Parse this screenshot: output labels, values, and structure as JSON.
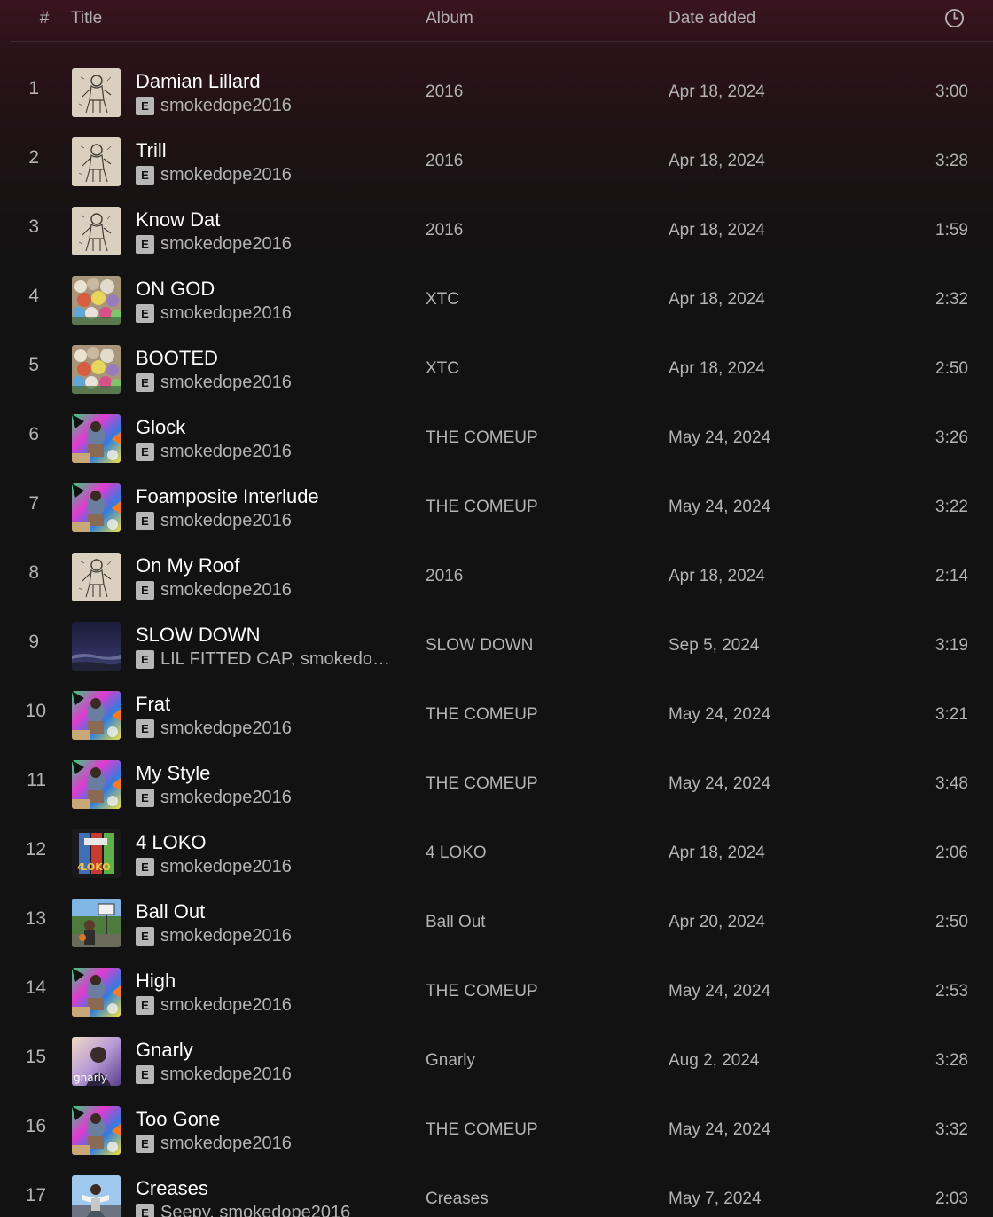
{
  "header": {
    "num_label": "#",
    "title_label": "Title",
    "album_label": "Album",
    "date_label": "Date added",
    "duration_icon": "clock-icon"
  },
  "tracks": [
    {
      "num": "1",
      "title": "Damian Lillard",
      "explicit": "E",
      "artist": "smokedope2016",
      "album": "2016",
      "date": "Apr 18, 2024",
      "duration": "3:00",
      "art": "art-2016"
    },
    {
      "num": "2",
      "title": "Trill",
      "explicit": "E",
      "artist": "smokedope2016",
      "album": "2016",
      "date": "Apr 18, 2024",
      "duration": "3:28",
      "art": "art-2016"
    },
    {
      "num": "3",
      "title": "Know Dat",
      "explicit": "E",
      "artist": "smokedope2016",
      "album": "2016",
      "date": "Apr 18, 2024",
      "duration": "1:59",
      "art": "art-2016"
    },
    {
      "num": "4",
      "title": "ON GOD",
      "explicit": "E",
      "artist": "smokedope2016",
      "album": "XTC",
      "date": "Apr 18, 2024",
      "duration": "2:32",
      "art": "art-xtc"
    },
    {
      "num": "5",
      "title": "BOOTED",
      "explicit": "E",
      "artist": "smokedope2016",
      "album": "XTC",
      "date": "Apr 18, 2024",
      "duration": "2:50",
      "art": "art-xtc"
    },
    {
      "num": "6",
      "title": "Glock",
      "explicit": "E",
      "artist": "smokedope2016",
      "album": "THE COMEUP",
      "date": "May 24, 2024",
      "duration": "3:26",
      "art": "art-comeup"
    },
    {
      "num": "7",
      "title": "Foamposite Interlude",
      "explicit": "E",
      "artist": "smokedope2016",
      "album": "THE COMEUP",
      "date": "May 24, 2024",
      "duration": "3:22",
      "art": "art-comeup"
    },
    {
      "num": "8",
      "title": "On My Roof",
      "explicit": "E",
      "artist": "smokedope2016",
      "album": "2016",
      "date": "Apr 18, 2024",
      "duration": "2:14",
      "art": "art-2016"
    },
    {
      "num": "9",
      "title": "SLOW DOWN",
      "explicit": "E",
      "artist": "LIL FITTED CAP, smokedope...",
      "album": "SLOW DOWN",
      "date": "Sep 5, 2024",
      "duration": "3:19",
      "art": "art-slowdown"
    },
    {
      "num": "10",
      "title": "Frat",
      "explicit": "E",
      "artist": "smokedope2016",
      "album": "THE COMEUP",
      "date": "May 24, 2024",
      "duration": "3:21",
      "art": "art-comeup"
    },
    {
      "num": "11",
      "title": "My Style",
      "explicit": "E",
      "artist": "smokedope2016",
      "album": "THE COMEUP",
      "date": "May 24, 2024",
      "duration": "3:48",
      "art": "art-comeup"
    },
    {
      "num": "12",
      "title": "4 LOKO",
      "explicit": "E",
      "artist": "smokedope2016",
      "album": "4 LOKO",
      "date": "Apr 18, 2024",
      "duration": "2:06",
      "art": "art-4loko"
    },
    {
      "num": "13",
      "title": "Ball Out",
      "explicit": "E",
      "artist": "smokedope2016",
      "album": "Ball Out",
      "date": "Apr 20, 2024",
      "duration": "2:50",
      "art": "art-ballout"
    },
    {
      "num": "14",
      "title": "High",
      "explicit": "E",
      "artist": "smokedope2016",
      "album": "THE COMEUP",
      "date": "May 24, 2024",
      "duration": "2:53",
      "art": "art-comeup"
    },
    {
      "num": "15",
      "title": "Gnarly",
      "explicit": "E",
      "artist": "smokedope2016",
      "album": "Gnarly",
      "date": "Aug 2, 2024",
      "duration": "3:28",
      "art": "art-gnarly",
      "art_text": "gnarly"
    },
    {
      "num": "16",
      "title": "Too Gone",
      "explicit": "E",
      "artist": "smokedope2016",
      "album": "THE COMEUP",
      "date": "May 24, 2024",
      "duration": "3:32",
      "art": "art-comeup"
    },
    {
      "num": "17",
      "title": "Creases",
      "explicit": "E",
      "artist": "Seepy, smokedope2016",
      "album": "Creases",
      "date": "May 7, 2024",
      "duration": "2:03",
      "art": "art-creases"
    }
  ],
  "colors": {
    "background": "#121212",
    "header_gradient_top": "#3a1420",
    "text_primary": "#ffffff",
    "text_secondary": "#b3b3b3",
    "explicit_badge": "#b7b7b7"
  }
}
